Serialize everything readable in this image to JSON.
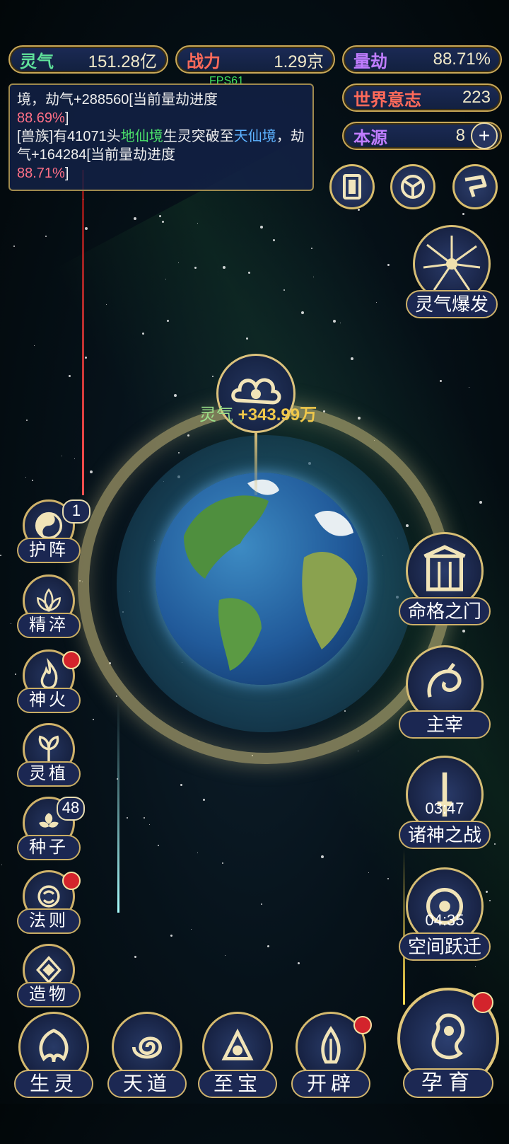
{
  "stats": {
    "lingqi": {
      "label": "灵气",
      "value": "151.28亿"
    },
    "zhanli": {
      "label": "战力",
      "value": "1.29京"
    },
    "liangjie": {
      "label": "量劫",
      "value": "88.71%"
    },
    "shijie_yizhi": {
      "label": "世界意志",
      "value": "223"
    },
    "benyuan": {
      "label": "本源",
      "value": "8"
    }
  },
  "fps": "FPS61",
  "log": {
    "line1_a": "境，劫气+288560[当前量劫进度",
    "line1_pct": "88.69%",
    "line1_end": "]",
    "line2_a": "[兽族]有41071头",
    "line2_realm1": "地仙境",
    "line2_b": "生灵突破至",
    "line2_realm2": "天仙境",
    "line2_c": "，劫气+164284[当前量劫进度",
    "line2_pct": "88.71%",
    "line2_end": "]"
  },
  "top_icons": [
    "card-icon",
    "vortex-icon",
    "flag-icon"
  ],
  "burst": {
    "label": "灵气爆发"
  },
  "gain": {
    "prefix": "灵气",
    "amount": "+343.99万"
  },
  "left_menu": [
    {
      "label": "护阵",
      "icon": "yin-yang-icon",
      "badge": "1"
    },
    {
      "label": "精淬",
      "icon": "lotus-icon"
    },
    {
      "label": "神火",
      "icon": "flame-icon",
      "dot": true
    },
    {
      "label": "灵植",
      "icon": "plant-icon"
    },
    {
      "label": "种子",
      "icon": "seed-icon",
      "badge": "48"
    },
    {
      "label": "法则",
      "icon": "rune-icon",
      "dot": true
    },
    {
      "label": "造物",
      "icon": "diamond-icon"
    }
  ],
  "right_menu": [
    {
      "label": "命格之门",
      "icon": "gate-icon"
    },
    {
      "label": "主宰",
      "icon": "dragon-icon"
    },
    {
      "label": "诸神之战",
      "icon": "sword-icon",
      "timer": "03:47"
    },
    {
      "label": "空间跃迁",
      "icon": "portal-icon",
      "timer": "04:35"
    }
  ],
  "bottom_menu": [
    {
      "label": "生灵",
      "icon": "phoenix-icon"
    },
    {
      "label": "天道",
      "icon": "swirl-icon"
    },
    {
      "label": "至宝",
      "icon": "treasure-icon"
    },
    {
      "label": "开辟",
      "icon": "axe-icon",
      "dot": true
    }
  ],
  "main_action": {
    "label": "孕育",
    "icon": "embryo-icon",
    "dot": true
  },
  "colors": {
    "gold": "#d4b96e",
    "panel": "#1b2752",
    "accent_red": "#d3242c"
  }
}
